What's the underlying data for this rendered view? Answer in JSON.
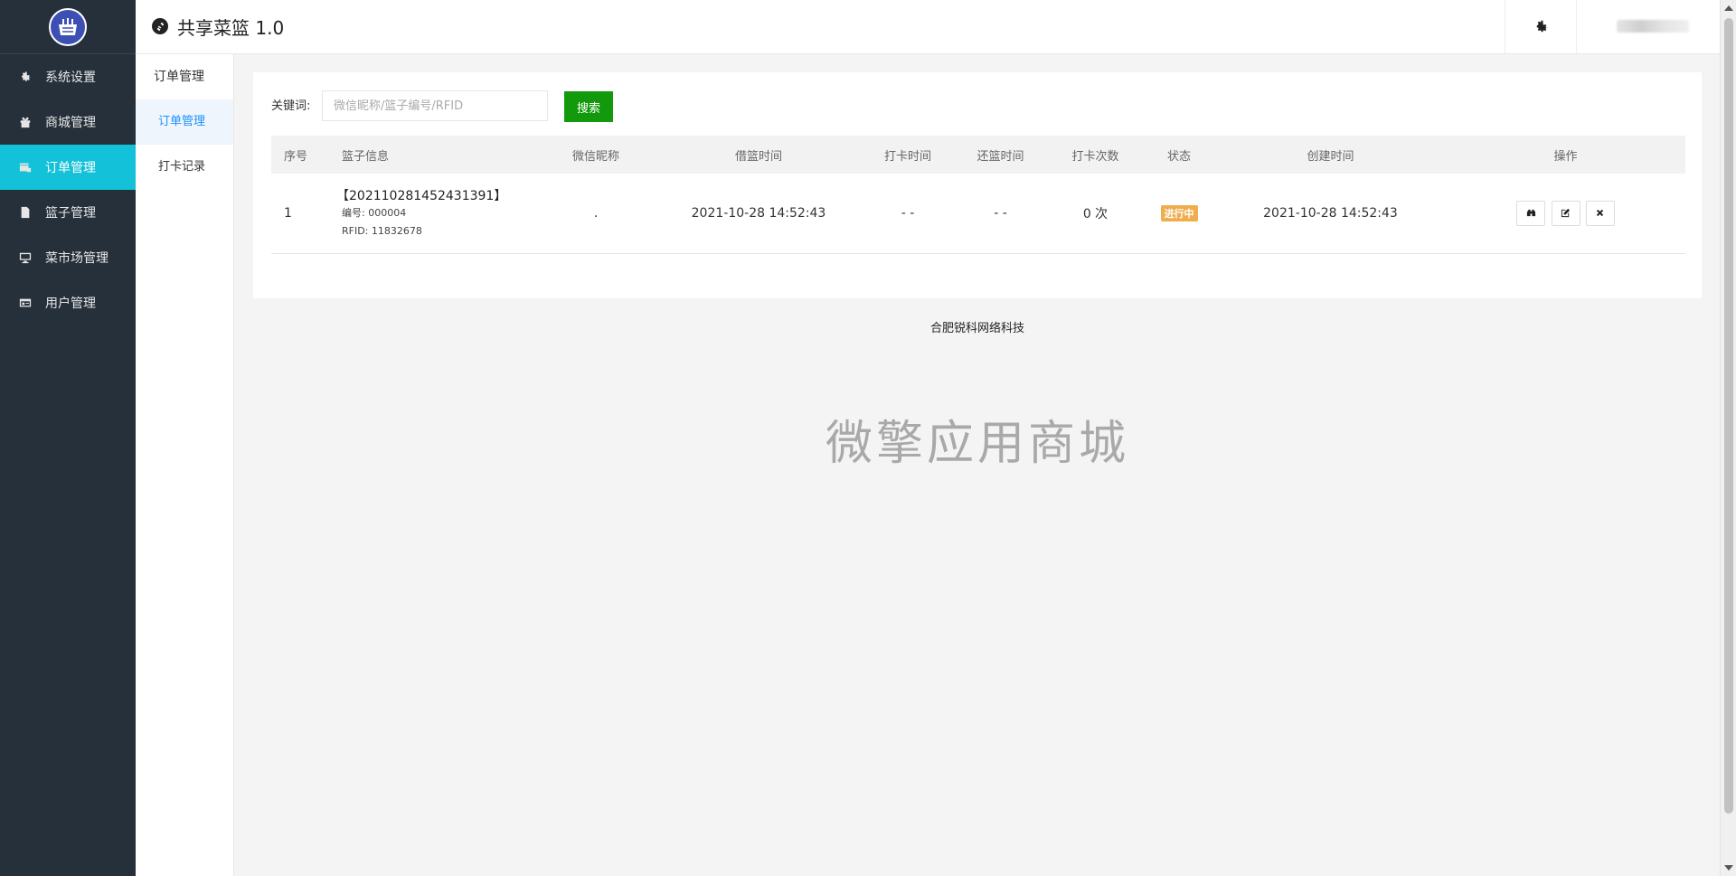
{
  "app": {
    "title": "共享菜篮 1.0"
  },
  "sidebar": {
    "items": [
      {
        "label": "系统设置",
        "icon": "gear-icon"
      },
      {
        "label": "商城管理",
        "icon": "gift-icon"
      },
      {
        "label": "订单管理",
        "icon": "order-icon",
        "active": true
      },
      {
        "label": "篮子管理",
        "icon": "file-icon"
      },
      {
        "label": "菜市场管理",
        "icon": "monitor-icon"
      },
      {
        "label": "用户管理",
        "icon": "user-card-icon"
      }
    ]
  },
  "subnav": {
    "title": "订单管理",
    "items": [
      {
        "label": "订单管理",
        "active": true
      },
      {
        "label": "打卡记录"
      }
    ]
  },
  "search": {
    "label": "关键词:",
    "placeholder": "微信昵称/篮子编号/RFID",
    "button": "搜索"
  },
  "table": {
    "headers": [
      "序号",
      "篮子信息",
      "微信昵称",
      "借篮时间",
      "打卡时间",
      "还篮时间",
      "打卡次数",
      "状态",
      "创建时间",
      "操作"
    ],
    "rows": [
      {
        "index": "1",
        "basket_id": "【202110281452431391】",
        "basket_no": "编号: 000004",
        "basket_rfid": "RFID: 11832678",
        "nickname": ".",
        "borrow_time": "2021-10-28 14:52:43",
        "checkin_time": "- -",
        "return_time": "- -",
        "checkin_count": "0 次",
        "status": "进行中",
        "created_time": "2021-10-28 14:52:43"
      }
    ]
  },
  "footer": {
    "text": "合肥锐科网络科技"
  },
  "watermark": {
    "text": "微擎应用商城"
  },
  "colors": {
    "sidebar_bg": "#26303b",
    "active_nav": "#13c2d8",
    "search_button": "#129a0c",
    "status_badge": "#f0ad4e"
  }
}
